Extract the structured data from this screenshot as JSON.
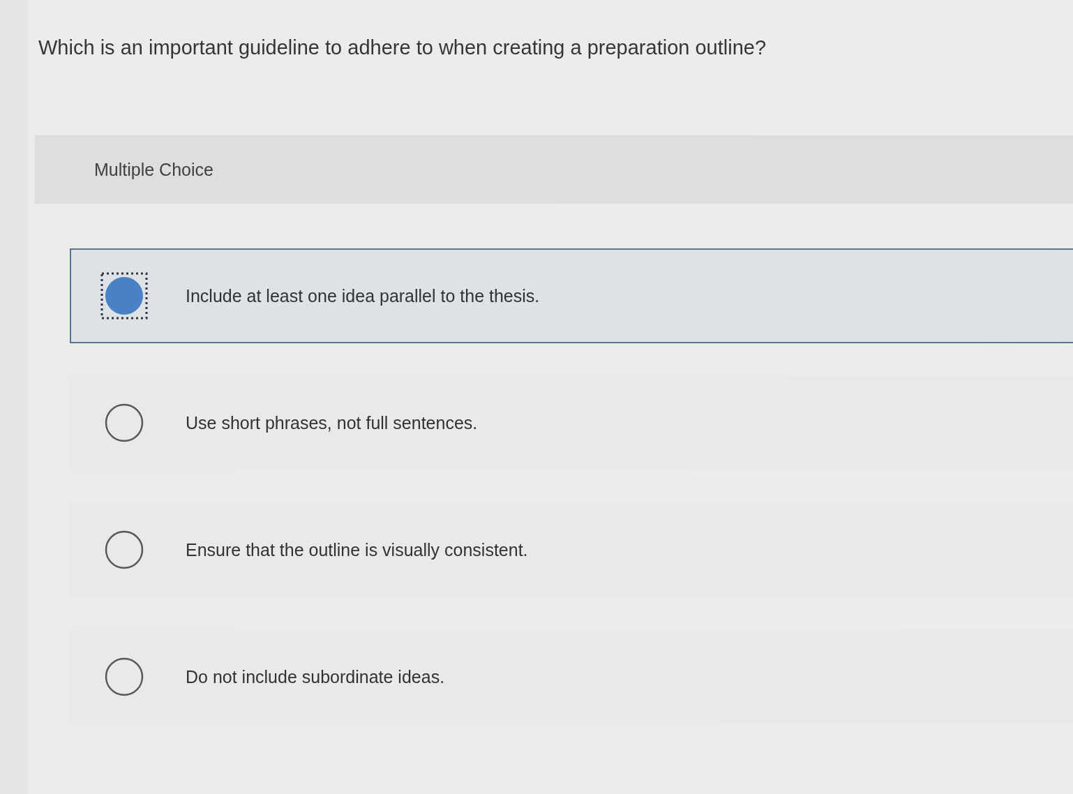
{
  "question": "Which is an important guideline to adhere to when creating a preparation outline?",
  "section": {
    "label": "Multiple Choice"
  },
  "options": [
    {
      "text": "Include at least one idea parallel to the thesis.",
      "selected": true
    },
    {
      "text": "Use short phrases, not full sentences.",
      "selected": false
    },
    {
      "text": "Ensure that the outline is visually consistent.",
      "selected": false
    },
    {
      "text": "Do not include subordinate ideas.",
      "selected": false
    }
  ]
}
